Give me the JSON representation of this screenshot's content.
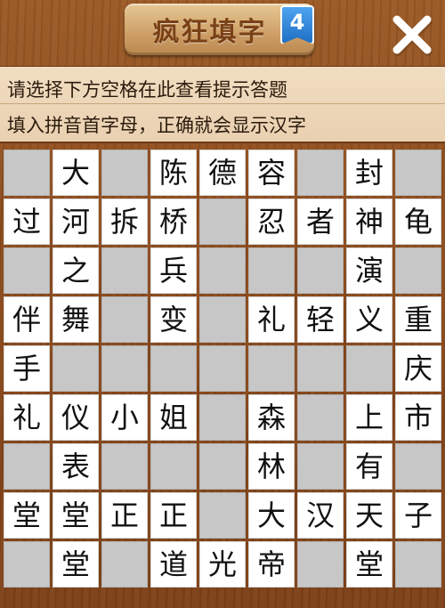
{
  "header": {
    "title": "疯狂填字",
    "level": "4",
    "close_icon": "close-x-icon"
  },
  "hints": {
    "line1": "请选择下方空格在此查看提示答题",
    "line2": "填入拼音首字母，正确就会显示汉字"
  },
  "colors": {
    "wood": "#8b4a1c",
    "plaque": "#d8b07a",
    "title_text": "#7a4116",
    "badge": "#2d82d8",
    "hint_bg": "#efd9bd",
    "cell_filled": "#ffffff",
    "cell_empty": "#c7c7c7"
  },
  "board": {
    "rows": [
      [
        "",
        "大",
        "",
        "陈",
        "德",
        "容",
        "",
        "封",
        ""
      ],
      [
        "过",
        "河",
        "拆",
        "桥",
        "",
        "忍",
        "者",
        "神",
        "龟"
      ],
      [
        "",
        "之",
        "",
        "兵",
        "",
        "",
        "",
        "演",
        ""
      ],
      [
        "伴",
        "舞",
        "",
        "变",
        "",
        "礼",
        "轻",
        "义",
        "重"
      ],
      [
        "手",
        "",
        "",
        "",
        "",
        "",
        "",
        "",
        "庆"
      ],
      [
        "礼",
        "仪",
        "小",
        "姐",
        "",
        "森",
        "",
        "上",
        "市"
      ],
      [
        "",
        "表",
        "",
        "",
        "",
        "林",
        "",
        "有",
        ""
      ],
      [
        "堂",
        "堂",
        "正",
        "正",
        "",
        "大",
        "汉",
        "天",
        "子"
      ],
      [
        "",
        "堂",
        "",
        "道",
        "光",
        "帝",
        "",
        "堂",
        ""
      ]
    ]
  }
}
